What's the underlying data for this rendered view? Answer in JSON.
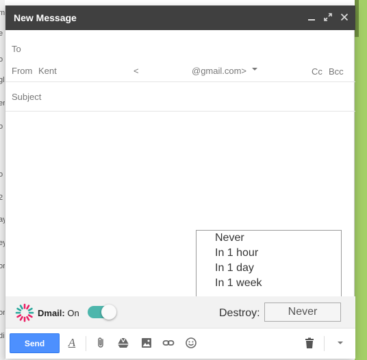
{
  "window": {
    "title": "New Message",
    "controls": [
      "minimize",
      "expand",
      "close"
    ]
  },
  "recipients": {
    "to_label": "To",
    "from_label": "From",
    "from_name": "Kent",
    "from_bracket_open": "<",
    "from_email_suffix": "@gmail.com>",
    "cc_label": "Cc",
    "bcc_label": "Bcc"
  },
  "subject": {
    "placeholder": "Subject"
  },
  "destroy_menu": {
    "options": [
      "Never",
      "In 1 hour",
      "In 1 day",
      "In 1 week"
    ]
  },
  "dmail": {
    "brand": "Dmail:",
    "status": "On",
    "toggle_on": true,
    "destroy_label": "Destroy:",
    "destroy_value": "Never",
    "toggle_color": "#4db6ac"
  },
  "toolbar": {
    "send_label": "Send",
    "send_color": "#4d90fe",
    "format_label": "A",
    "icons": [
      "format-text-icon",
      "paperclip-icon",
      "drive-icon",
      "photo-icon",
      "link-icon",
      "emoji-icon",
      "trash-icon",
      "more-options-icon"
    ]
  },
  "colors": {
    "titlebar": "#404040",
    "sidebar_green": "#a4cf68"
  }
}
